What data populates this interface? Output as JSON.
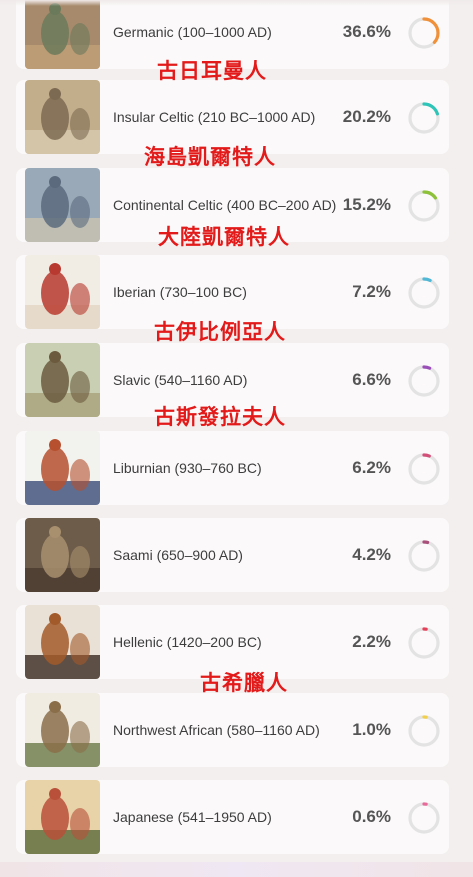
{
  "rows": [
    {
      "name": "Germanic (100–1000 AD)",
      "percent": "36.6%",
      "value": 0.366,
      "color": "#f0913a",
      "thumb": [
        "#a78a6c",
        "#6b7a5b",
        "#c2a078"
      ]
    },
    {
      "name": "Insular Celtic (210 BC–1000 AD)",
      "percent": "20.2%",
      "value": 0.202,
      "color": "#2fc4b8",
      "thumb": [
        "#c3ae8c",
        "#7d6a52",
        "#d8cbb0"
      ]
    },
    {
      "name": "Continental Celtic (400 BC–200 AD)",
      "percent": "15.2%",
      "value": 0.152,
      "color": "#8dc13a",
      "thumb": [
        "#9aa9b8",
        "#5b6b7d",
        "#c9c3b2"
      ]
    },
    {
      "name": "Iberian (730–100 BC)",
      "percent": "7.2%",
      "value": 0.072,
      "color": "#4fb8d6",
      "thumb": [
        "#f1ece4",
        "#b8392f",
        "#e3d7c4"
      ]
    },
    {
      "name": "Slavic (540–1160 AD)",
      "percent": "6.6%",
      "value": 0.066,
      "color": "#9a4fb8",
      "thumb": [
        "#c8cfb2",
        "#6b5a3e",
        "#a8a17a"
      ]
    },
    {
      "name": "Liburnian (930–760 BC)",
      "percent": "6.2%",
      "value": 0.062,
      "color": "#d24f7a",
      "thumb": [
        "#f2f2ee",
        "#b6502f",
        "#3a4b78"
      ]
    },
    {
      "name": "Saami (650–900 AD)",
      "percent": "4.2%",
      "value": 0.042,
      "color": "#a84f7a",
      "thumb": [
        "#6e5c4a",
        "#a88f6e",
        "#4a3b2e"
      ]
    },
    {
      "name": "Hellenic (1420–200 BC)",
      "percent": "2.2%",
      "value": 0.022,
      "color": "#e5405a",
      "thumb": [
        "#e9e1d6",
        "#a35a2a",
        "#3a2a22"
      ]
    },
    {
      "name": "Northwest African (580–1160 AD)",
      "percent": "1.0%",
      "value": 0.01,
      "color": "#f2cf4a",
      "thumb": [
        "#f0ece2",
        "#8a6e4a",
        "#6b7a4a"
      ]
    },
    {
      "name": "Japanese (541–1950 AD)",
      "percent": "0.6%",
      "value": 0.006,
      "color": "#e86a9a",
      "thumb": [
        "#e8d2a8",
        "#b8503a",
        "#5a6a3a"
      ]
    }
  ],
  "overlays": [
    {
      "text": "古日耳曼人"
    },
    {
      "text": "海島凱爾特人"
    },
    {
      "text": "大陸凱爾特人"
    },
    {
      "text": "古伊比例亞人"
    },
    {
      "text": "古斯發拉夫人"
    },
    {
      "text": "古希臘人"
    }
  ]
}
